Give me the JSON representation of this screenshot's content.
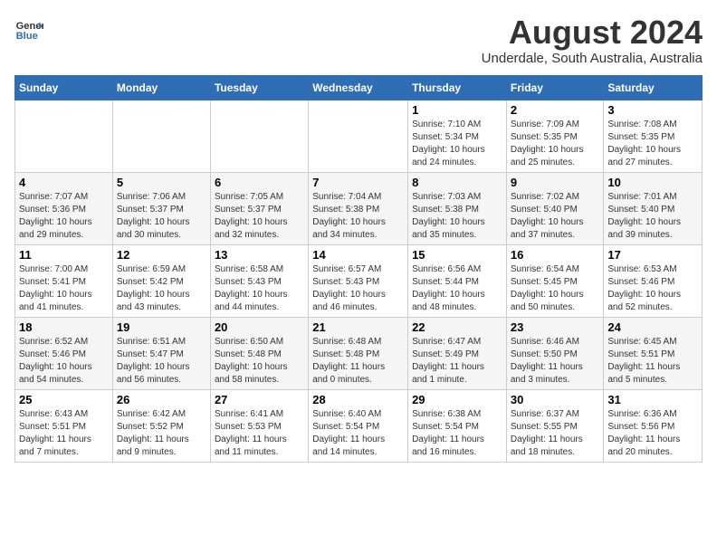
{
  "header": {
    "logo_line1": "General",
    "logo_line2": "Blue",
    "title": "August 2024",
    "subtitle": "Underdale, South Australia, Australia"
  },
  "weekdays": [
    "Sunday",
    "Monday",
    "Tuesday",
    "Wednesday",
    "Thursday",
    "Friday",
    "Saturday"
  ],
  "weeks": [
    [
      {
        "num": "",
        "info": ""
      },
      {
        "num": "",
        "info": ""
      },
      {
        "num": "",
        "info": ""
      },
      {
        "num": "",
        "info": ""
      },
      {
        "num": "1",
        "info": "Sunrise: 7:10 AM\nSunset: 5:34 PM\nDaylight: 10 hours\nand 24 minutes."
      },
      {
        "num": "2",
        "info": "Sunrise: 7:09 AM\nSunset: 5:35 PM\nDaylight: 10 hours\nand 25 minutes."
      },
      {
        "num": "3",
        "info": "Sunrise: 7:08 AM\nSunset: 5:35 PM\nDaylight: 10 hours\nand 27 minutes."
      }
    ],
    [
      {
        "num": "4",
        "info": "Sunrise: 7:07 AM\nSunset: 5:36 PM\nDaylight: 10 hours\nand 29 minutes."
      },
      {
        "num": "5",
        "info": "Sunrise: 7:06 AM\nSunset: 5:37 PM\nDaylight: 10 hours\nand 30 minutes."
      },
      {
        "num": "6",
        "info": "Sunrise: 7:05 AM\nSunset: 5:37 PM\nDaylight: 10 hours\nand 32 minutes."
      },
      {
        "num": "7",
        "info": "Sunrise: 7:04 AM\nSunset: 5:38 PM\nDaylight: 10 hours\nand 34 minutes."
      },
      {
        "num": "8",
        "info": "Sunrise: 7:03 AM\nSunset: 5:38 PM\nDaylight: 10 hours\nand 35 minutes."
      },
      {
        "num": "9",
        "info": "Sunrise: 7:02 AM\nSunset: 5:40 PM\nDaylight: 10 hours\nand 37 minutes."
      },
      {
        "num": "10",
        "info": "Sunrise: 7:01 AM\nSunset: 5:40 PM\nDaylight: 10 hours\nand 39 minutes."
      }
    ],
    [
      {
        "num": "11",
        "info": "Sunrise: 7:00 AM\nSunset: 5:41 PM\nDaylight: 10 hours\nand 41 minutes."
      },
      {
        "num": "12",
        "info": "Sunrise: 6:59 AM\nSunset: 5:42 PM\nDaylight: 10 hours\nand 43 minutes."
      },
      {
        "num": "13",
        "info": "Sunrise: 6:58 AM\nSunset: 5:43 PM\nDaylight: 10 hours\nand 44 minutes."
      },
      {
        "num": "14",
        "info": "Sunrise: 6:57 AM\nSunset: 5:43 PM\nDaylight: 10 hours\nand 46 minutes."
      },
      {
        "num": "15",
        "info": "Sunrise: 6:56 AM\nSunset: 5:44 PM\nDaylight: 10 hours\nand 48 minutes."
      },
      {
        "num": "16",
        "info": "Sunrise: 6:54 AM\nSunset: 5:45 PM\nDaylight: 10 hours\nand 50 minutes."
      },
      {
        "num": "17",
        "info": "Sunrise: 6:53 AM\nSunset: 5:46 PM\nDaylight: 10 hours\nand 52 minutes."
      }
    ],
    [
      {
        "num": "18",
        "info": "Sunrise: 6:52 AM\nSunset: 5:46 PM\nDaylight: 10 hours\nand 54 minutes."
      },
      {
        "num": "19",
        "info": "Sunrise: 6:51 AM\nSunset: 5:47 PM\nDaylight: 10 hours\nand 56 minutes."
      },
      {
        "num": "20",
        "info": "Sunrise: 6:50 AM\nSunset: 5:48 PM\nDaylight: 10 hours\nand 58 minutes."
      },
      {
        "num": "21",
        "info": "Sunrise: 6:48 AM\nSunset: 5:48 PM\nDaylight: 11 hours\nand 0 minutes."
      },
      {
        "num": "22",
        "info": "Sunrise: 6:47 AM\nSunset: 5:49 PM\nDaylight: 11 hours\nand 1 minute."
      },
      {
        "num": "23",
        "info": "Sunrise: 6:46 AM\nSunset: 5:50 PM\nDaylight: 11 hours\nand 3 minutes."
      },
      {
        "num": "24",
        "info": "Sunrise: 6:45 AM\nSunset: 5:51 PM\nDaylight: 11 hours\nand 5 minutes."
      }
    ],
    [
      {
        "num": "25",
        "info": "Sunrise: 6:43 AM\nSunset: 5:51 PM\nDaylight: 11 hours\nand 7 minutes."
      },
      {
        "num": "26",
        "info": "Sunrise: 6:42 AM\nSunset: 5:52 PM\nDaylight: 11 hours\nand 9 minutes."
      },
      {
        "num": "27",
        "info": "Sunrise: 6:41 AM\nSunset: 5:53 PM\nDaylight: 11 hours\nand 11 minutes."
      },
      {
        "num": "28",
        "info": "Sunrise: 6:40 AM\nSunset: 5:54 PM\nDaylight: 11 hours\nand 14 minutes."
      },
      {
        "num": "29",
        "info": "Sunrise: 6:38 AM\nSunset: 5:54 PM\nDaylight: 11 hours\nand 16 minutes."
      },
      {
        "num": "30",
        "info": "Sunrise: 6:37 AM\nSunset: 5:55 PM\nDaylight: 11 hours\nand 18 minutes."
      },
      {
        "num": "31",
        "info": "Sunrise: 6:36 AM\nSunset: 5:56 PM\nDaylight: 11 hours\nand 20 minutes."
      }
    ]
  ]
}
